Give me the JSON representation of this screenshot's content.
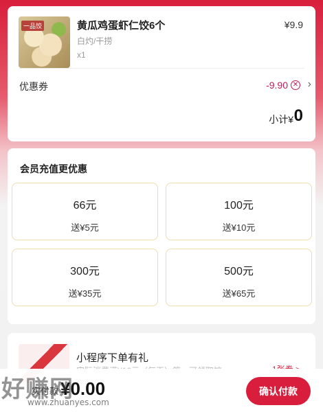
{
  "order": {
    "item_name": "黄瓜鸡蛋虾仁饺6个",
    "item_price": "¥9.9",
    "item_spec": "白灼/干捞",
    "item_qty": "x1",
    "thumb_badge": "一品饺",
    "coupon_label": "优惠券",
    "coupon_value": "-9.90",
    "subtotal_label": "小计¥",
    "subtotal_value": "0"
  },
  "recharge": {
    "title": "会员充值更优惠",
    "tiers": [
      {
        "amount": "66元",
        "bonus": "送¥5元"
      },
      {
        "amount": "100元",
        "bonus": "送¥10元"
      },
      {
        "amount": "300元",
        "bonus": "送¥35元"
      },
      {
        "amount": "500元",
        "bonus": "送¥65元"
      }
    ]
  },
  "promo": {
    "title": "小程序下单有礼",
    "subtitle": "实际消费满¥10元（每天）第一可领取饺",
    "tag": "1张券 >"
  },
  "bottom": {
    "pay_label": "实付款",
    "pay_amount": "¥0.00",
    "pay_button": "确认付款"
  },
  "watermark": {
    "text": "好赚网",
    "url": "www.zhuanyes.com"
  },
  "icons": {
    "coupon_clear": "close-circle-icon",
    "coupon_arrow": "chevron-right-icon"
  },
  "colors": {
    "brand_red": "#d81e3c",
    "coupon_pink": "#c2185b",
    "tier_border": "#ecdcae"
  }
}
